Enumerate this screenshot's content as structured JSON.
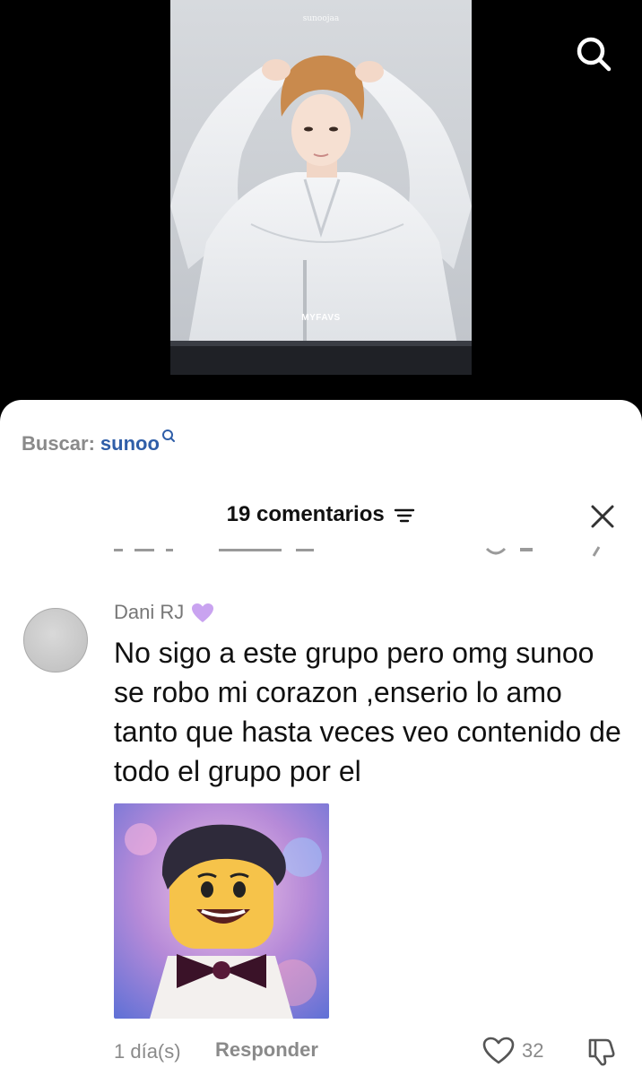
{
  "video": {
    "watermark_top": "sunoojaa",
    "watermark_center": "MYFAVS"
  },
  "search_bar": {
    "prefix": "Buscar:",
    "term": "sunoo"
  },
  "comments_header": {
    "count_label": "19 comentarios"
  },
  "comment": {
    "username": "Dani RJ",
    "text": "No sigo a este grupo pero omg sunoo se robo mi corazon ,enserio lo amo tanto que hasta veces veo contenido de todo el grupo por el",
    "timestamp": "1 día(s)",
    "reply_label": "Responder",
    "like_count": "32"
  },
  "icons": {
    "search": "search-icon",
    "filter": "filter-icon",
    "close": "close-icon",
    "heart_badge": "purple-heart-icon",
    "like": "heart-outline-icon",
    "dislike": "thumbs-down-icon"
  },
  "colors": {
    "search_term": "#2f5ea8",
    "muted_text": "#8a8a8a",
    "heart_badge": "#c9a3f0"
  }
}
